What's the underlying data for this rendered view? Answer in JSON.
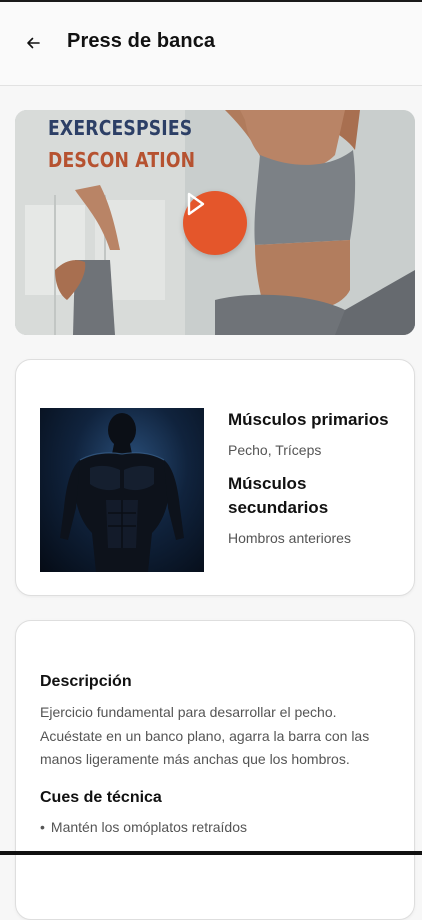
{
  "header": {
    "title": "Press de banca",
    "back_icon": "arrow-left-icon"
  },
  "hero": {
    "overlay_line_1": "EXERCESPSIES",
    "overlay_line_2": "DESCON ATION",
    "play_icon": "play-icon",
    "accent": "#e4562b"
  },
  "muscles": {
    "primary_heading": "Músculos primarios",
    "primary_value": "Pecho, Tríceps",
    "secondary_heading_line_1": "Músculos",
    "secondary_heading_line_2": "secundarios",
    "secondary_value": "Hombros anteriores"
  },
  "description": {
    "heading": "Descripción",
    "body": "Ejercicio fundamental para desarrollar el pecho. Acuéstate en un banco plano, agarra la barra con las manos ligeramente más anchas que los hombros.",
    "cues_heading": "Cues de técnica",
    "cues": [
      "Mantén los omóplatos retraídos"
    ]
  }
}
